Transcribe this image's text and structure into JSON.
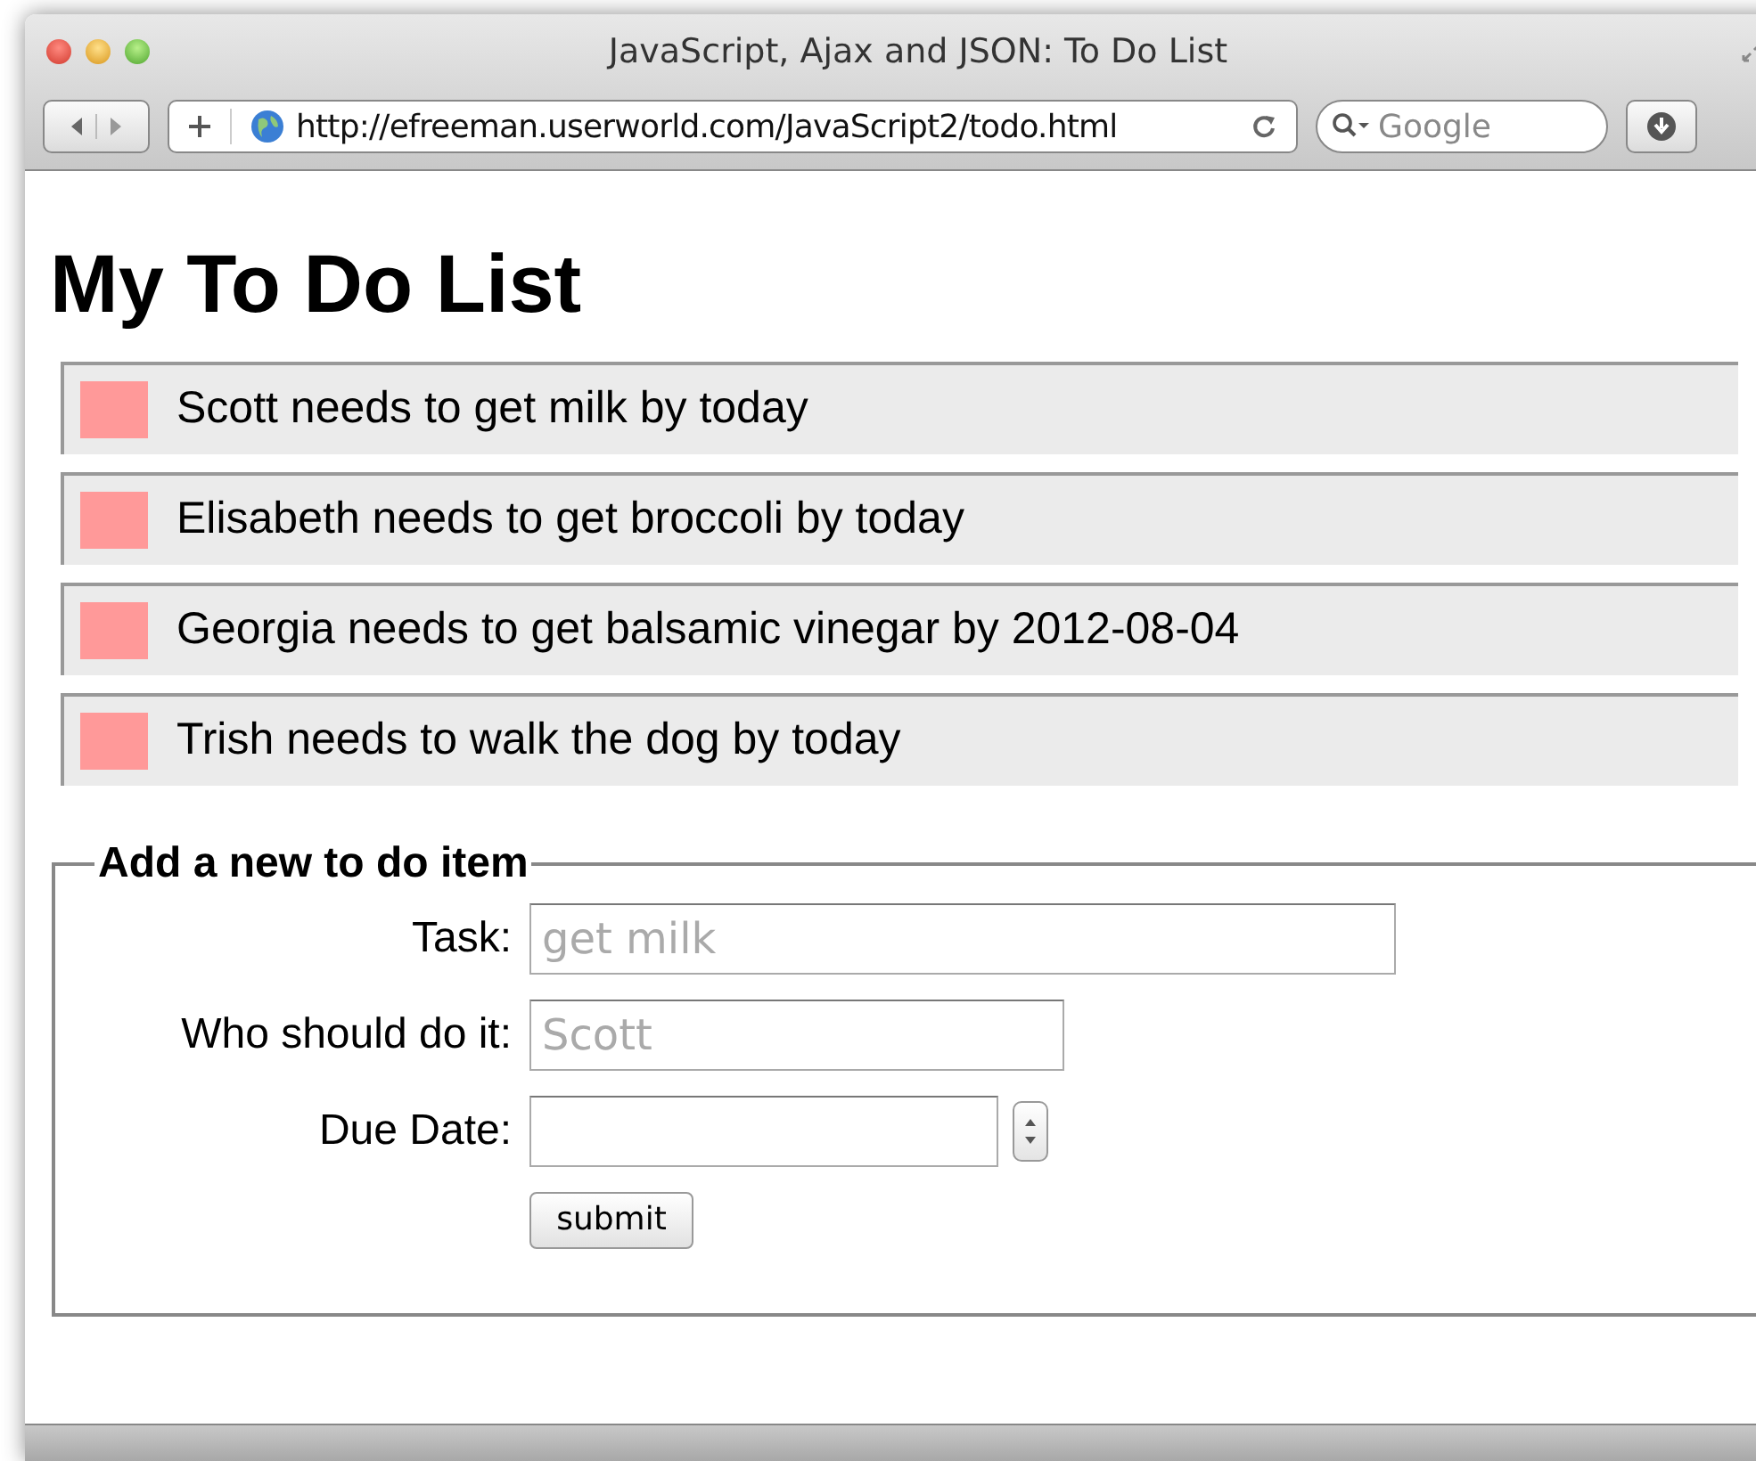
{
  "window": {
    "title": "JavaScript, Ajax and JSON: To Do List"
  },
  "toolbar": {
    "url": "http://efreeman.userworld.com/JavaScript2/todo.html",
    "search_placeholder": "Google"
  },
  "heading": "My To Do List",
  "todos": [
    {
      "text": "Scott needs to get milk by today",
      "color": "#ff9999"
    },
    {
      "text": "Elisabeth needs to get broccoli by today",
      "color": "#ff9999"
    },
    {
      "text": "Georgia needs to get balsamic vinegar by 2012-08-04",
      "color": "#ff9999"
    },
    {
      "text": "Trish needs to walk the dog by today",
      "color": "#ff9999"
    }
  ],
  "form": {
    "legend": "Add a new to do item",
    "fields": [
      {
        "kind": "text",
        "label": "Task:",
        "placeholder": "get milk"
      },
      {
        "kind": "short",
        "label": "Who should do it:",
        "placeholder": "Scott"
      },
      {
        "kind": "date",
        "label": "Due Date:"
      }
    ],
    "submit": "submit"
  }
}
